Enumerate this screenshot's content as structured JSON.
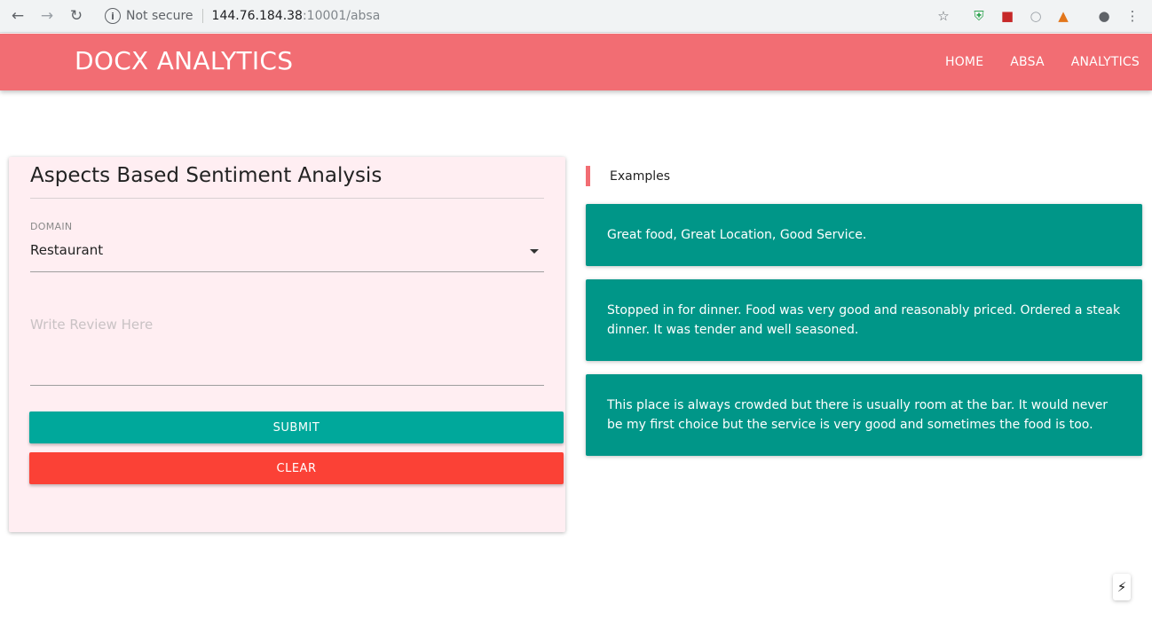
{
  "browser": {
    "security_label": "Not secure",
    "url_host": "144.76.184.38",
    "url_path": ":10001/absa"
  },
  "header": {
    "brand": "DOCX ANALYTICS",
    "nav": [
      "HOME",
      "ABSA",
      "ANALYTICS"
    ]
  },
  "form": {
    "title": "Aspects Based Sentiment Analysis",
    "domain_label": "DOMAIN",
    "domain_value": "Restaurant",
    "review_placeholder": "Write Review Here",
    "submit_label": "SUBMIT",
    "clear_label": "CLEAR"
  },
  "examples": {
    "heading": "Examples",
    "items": [
      "Great food, Great Location, Good Service.",
      "Stopped in for dinner. Food was very good and reasonably priced. Ordered a steak dinner. It was tender and well seasoned.",
      "This place is always crowded but there is usually room at the bar. It would never be my first choice but the service is very good and sometimes the food is too."
    ]
  },
  "colors": {
    "header": "#f26d73",
    "card": "#ffeef2",
    "submit": "#00a89b",
    "clear": "#fb4136",
    "example": "#009688"
  }
}
